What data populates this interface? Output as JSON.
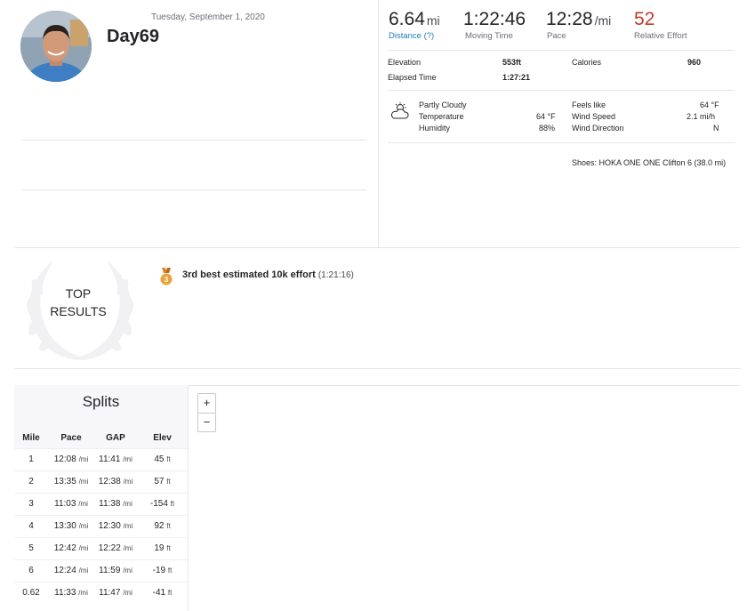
{
  "activity": {
    "date": "Tuesday, September 1, 2020",
    "title": "Day69"
  },
  "stats": {
    "distance": {
      "value": "6.64",
      "unit": "mi",
      "label": "Distance (?)"
    },
    "moving_time": {
      "value": "1:22:46",
      "label": "Moving Time"
    },
    "pace": {
      "value": "12:28",
      "unit": "/mi",
      "label": "Pace"
    },
    "relative_effort": {
      "value": "52",
      "label": "Relative Effort"
    }
  },
  "details": {
    "elevation_label": "Elevation",
    "elevation_value": "553ft",
    "calories_label": "Calories",
    "calories_value": "960",
    "elapsed_label": "Elapsed Time",
    "elapsed_value": "1:27:21"
  },
  "weather": {
    "condition": "Partly Cloudy",
    "temperature_label": "Temperature",
    "temperature_value": "64 °F",
    "humidity_label": "Humidity",
    "humidity_value": "88%",
    "feels_like_label": "Feels like",
    "feels_like_value": "64 °F",
    "wind_speed_label": "Wind Speed",
    "wind_speed_value": "2.1 mi/h",
    "wind_direction_label": "Wind Direction",
    "wind_direction_value": "N",
    "icon": "partly-cloudy-icon"
  },
  "shoes": "Shoes: HOKA ONE ONE Clifton 6 (38.0 mi)",
  "top_results": {
    "line1": "TOP",
    "line2": "RESULTS",
    "achievement": "3rd best estimated 10k effort",
    "achievement_time": "(1:21:16)",
    "medal_number": "3"
  },
  "splits": {
    "title": "Splits",
    "headers": [
      "Mile",
      "Pace",
      "GAP",
      "Elev"
    ],
    "pace_unit": "/mi",
    "elev_unit": "ft",
    "rows": [
      {
        "mile": "1",
        "pace": "12:08",
        "gap": "11:41",
        "elev": "45"
      },
      {
        "mile": "2",
        "pace": "13:35",
        "gap": "12:38",
        "elev": "57"
      },
      {
        "mile": "3",
        "pace": "11:03",
        "gap": "11:38",
        "elev": "-154"
      },
      {
        "mile": "4",
        "pace": "13:30",
        "gap": "12:30",
        "elev": "92"
      },
      {
        "mile": "5",
        "pace": "12:42",
        "gap": "12:22",
        "elev": "19"
      },
      {
        "mile": "6",
        "pace": "12:24",
        "gap": "11:59",
        "elev": "-19"
      },
      {
        "mile": "0.62",
        "pace": "11:33",
        "gap": "11:47",
        "elev": "-41"
      }
    ]
  },
  "map": {
    "zoom_in": "+",
    "zoom_out": "−"
  },
  "colors": {
    "accent_link": "#1a7fb3",
    "effort_red": "#c0392b",
    "medal": "#e8a33a"
  }
}
